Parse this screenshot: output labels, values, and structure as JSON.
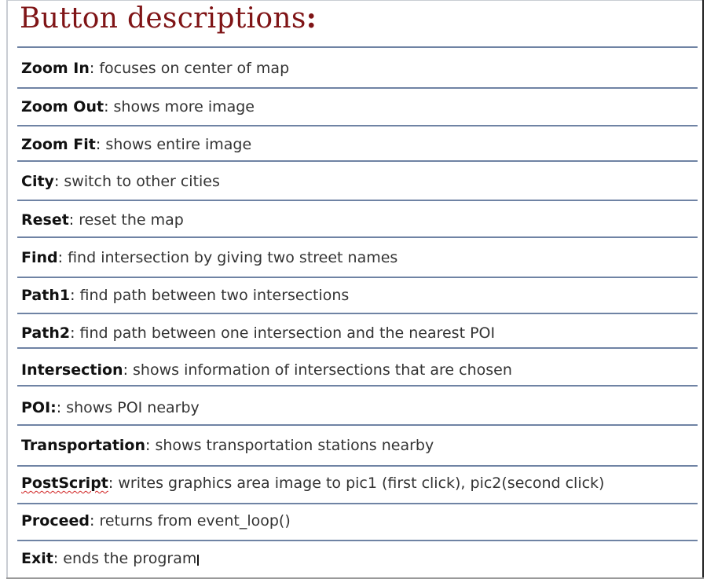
{
  "title": "Button descriptions",
  "title_colon": ":",
  "separator": ": ",
  "buttons": [
    {
      "name": "Zoom In",
      "description": "focuses on center of map"
    },
    {
      "name": "Zoom Out",
      "description": "shows more image"
    },
    {
      "name": "Zoom Fit",
      "description": "shows entire image"
    },
    {
      "name": "City",
      "description": "switch to other cities"
    },
    {
      "name": "Reset",
      "description": "reset the map"
    },
    {
      "name": "Find",
      "description": "find intersection by giving two street names"
    },
    {
      "name": "Path1",
      "description": "find path between two intersections"
    },
    {
      "name": "Path2",
      "description": "find path between one intersection and the nearest POI"
    },
    {
      "name": "Intersection",
      "description": "shows information of intersections that are chosen"
    },
    {
      "name": "POI:",
      "description": "shows POI nearby"
    },
    {
      "name": "Transportation",
      "description": "shows transportation stations nearby"
    },
    {
      "name": "PostScript",
      "description": "writes graphics area image to pic1 (first click), pic2(second click)"
    },
    {
      "name": "Proceed",
      "description": "returns from event_loop()"
    },
    {
      "name": "Exit",
      "description": "ends the program"
    }
  ],
  "colors": {
    "title": "#7f1416",
    "rule": "#6f83a4",
    "spellcheck_underline": "#d02020"
  }
}
